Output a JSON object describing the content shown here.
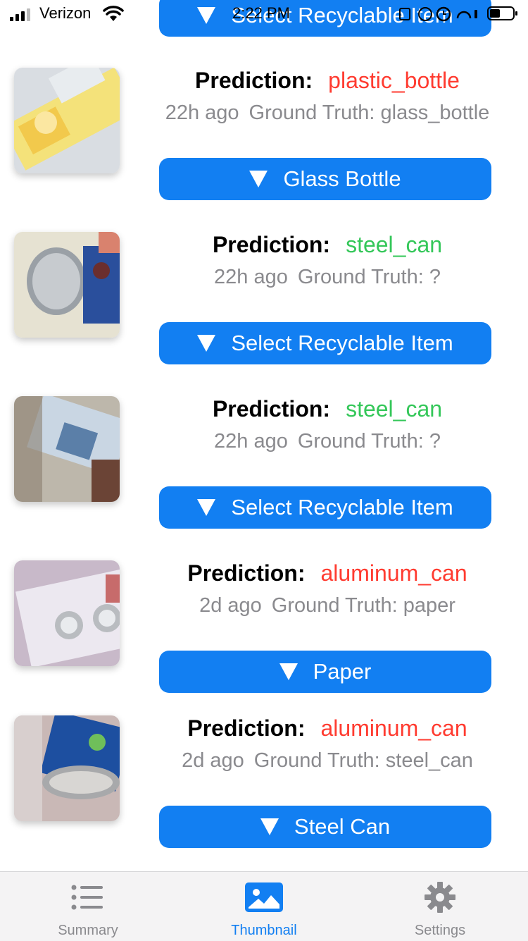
{
  "status_bar": {
    "carrier": "Verizon",
    "time": "2:22 PM"
  },
  "top_partial_button": {
    "label": "Select Recyclable Item"
  },
  "prediction_label": "Prediction:",
  "ground_truth_label": "Ground Truth:",
  "colors": {
    "accent": "#127ff2",
    "correct": "#34c759",
    "incorrect": "#ff3b30",
    "secondary_text": "#8a8a8e"
  },
  "items": [
    {
      "prediction": "plastic_bottle",
      "prediction_status": "incorrect",
      "age": "22h ago",
      "ground_truth": "glass_bottle",
      "button_label": "Glass Bottle",
      "thumbnail": "image-thumbnail"
    },
    {
      "prediction": "steel_can",
      "prediction_status": "correct",
      "age": "22h ago",
      "ground_truth": "?",
      "button_label": "Select Recyclable Item",
      "thumbnail": "image-thumbnail"
    },
    {
      "prediction": "steel_can",
      "prediction_status": "correct",
      "age": "22h ago",
      "ground_truth": "?",
      "button_label": "Select Recyclable Item",
      "thumbnail": "image-thumbnail"
    },
    {
      "prediction": "aluminum_can",
      "prediction_status": "incorrect",
      "age": "2d ago",
      "ground_truth": "paper",
      "button_label": "Paper",
      "thumbnail": "image-thumbnail"
    },
    {
      "prediction": "aluminum_can",
      "prediction_status": "incorrect",
      "age": "2d ago",
      "ground_truth": "steel_can",
      "button_label": "Steel Can",
      "thumbnail": "image-thumbnail"
    }
  ],
  "tabs": [
    {
      "label": "Summary",
      "icon": "list-icon",
      "active": false
    },
    {
      "label": "Thumbnail",
      "icon": "photo-icon",
      "active": true
    },
    {
      "label": "Settings",
      "icon": "gear-icon",
      "active": false
    }
  ]
}
